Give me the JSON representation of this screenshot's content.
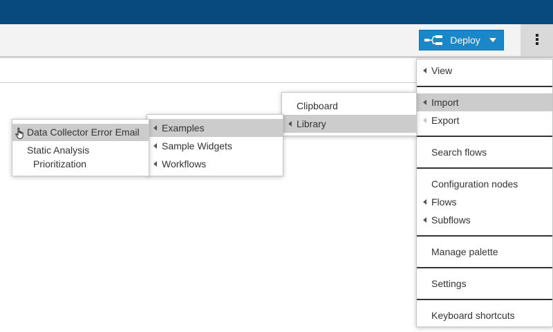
{
  "toolbar": {
    "deploy_label": "Deploy"
  },
  "main_menu": {
    "items": [
      {
        "label": "View"
      },
      {
        "label": "Import"
      },
      {
        "label": "Export"
      },
      {
        "label": "Search flows"
      },
      {
        "label": "Configuration nodes"
      },
      {
        "label": "Flows"
      },
      {
        "label": "Subflows"
      },
      {
        "label": "Manage palette"
      },
      {
        "label": "Settings"
      },
      {
        "label": "Keyboard shortcuts"
      }
    ]
  },
  "import_menu": {
    "items": [
      {
        "label": "Clipboard"
      },
      {
        "label": "Library"
      }
    ]
  },
  "library_menu": {
    "items": [
      {
        "label": "Examples"
      },
      {
        "label": "Sample Widgets"
      },
      {
        "label": "Workflows"
      }
    ]
  },
  "examples_menu": {
    "items": [
      {
        "label": "Data Collector Error Email"
      },
      {
        "label": "Static Analysis"
      },
      {
        "label": "Prioritization"
      }
    ]
  },
  "colors": {
    "header": "#084A7E",
    "deploy": "#1a87c8",
    "active_item": "#cccccc"
  }
}
